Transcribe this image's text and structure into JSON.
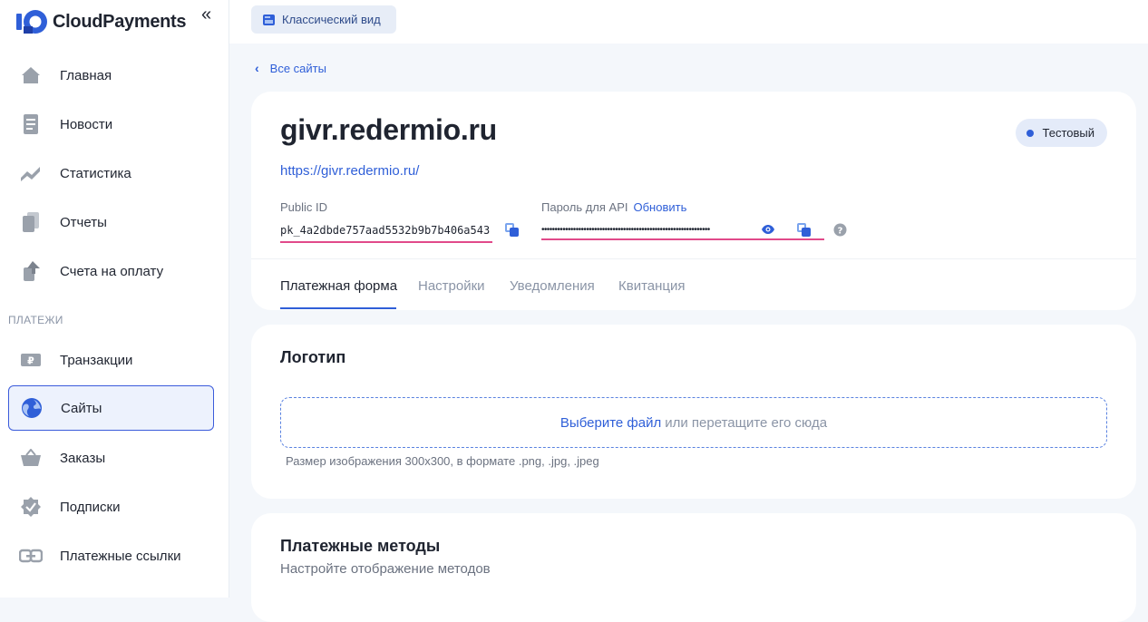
{
  "sidebar": {
    "brand": "CloudPayments",
    "collapse_icon": "«",
    "section_payments": "ПЛАТЕЖИ",
    "items": [
      {
        "label": "Главная",
        "icon": "home-icon"
      },
      {
        "label": "Новости",
        "icon": "news-icon"
      },
      {
        "label": "Статистика",
        "icon": "chart-icon"
      },
      {
        "label": "Отчеты",
        "icon": "reports-icon"
      },
      {
        "label": "Счета на оплату",
        "icon": "invoice-icon"
      },
      {
        "label": "Транзакции",
        "icon": "ruble-icon"
      },
      {
        "label": "Сайты",
        "icon": "globe-icon",
        "active": true
      },
      {
        "label": "Заказы",
        "icon": "basket-icon"
      },
      {
        "label": "Подписки",
        "icon": "badge-check-icon"
      },
      {
        "label": "Платежные ссылки",
        "icon": "link-icon"
      }
    ]
  },
  "topbar": {
    "classic_view": "Классический вид"
  },
  "breadcrumb": {
    "back": "Все сайты"
  },
  "site": {
    "title": "givr.redermio.ru",
    "url": "https://givr.redermio.ru/",
    "status": "Тестовый",
    "public_id_label": "Public ID",
    "public_id": "pk_4a2dbde757aad5532b9b7b406a543",
    "api_pass_label": "Пароль для API",
    "api_refresh": "Обновить",
    "api_pass_mask": "••••••••••••••••••••••••••••••••••••••••••••••••••••••••••••••••"
  },
  "tabs": [
    {
      "label": "Платежная форма",
      "active": true
    },
    {
      "label": "Настройки"
    },
    {
      "label": "Уведомления"
    },
    {
      "label": "Квитанция"
    }
  ],
  "logo_card": {
    "title": "Логотип",
    "choose": "Выберите файл",
    "drop": "или перетащите его сюда",
    "hint": "Размер изображения 300x300, в формате .png, .jpg, .jpeg"
  },
  "methods_card": {
    "title": "Платежные методы",
    "subtitle": "Настройте отображение методов"
  },
  "colors": {
    "accent": "#2f5fd8",
    "underline": "#e14a8a",
    "icon_gray": "#9aa1ab"
  }
}
